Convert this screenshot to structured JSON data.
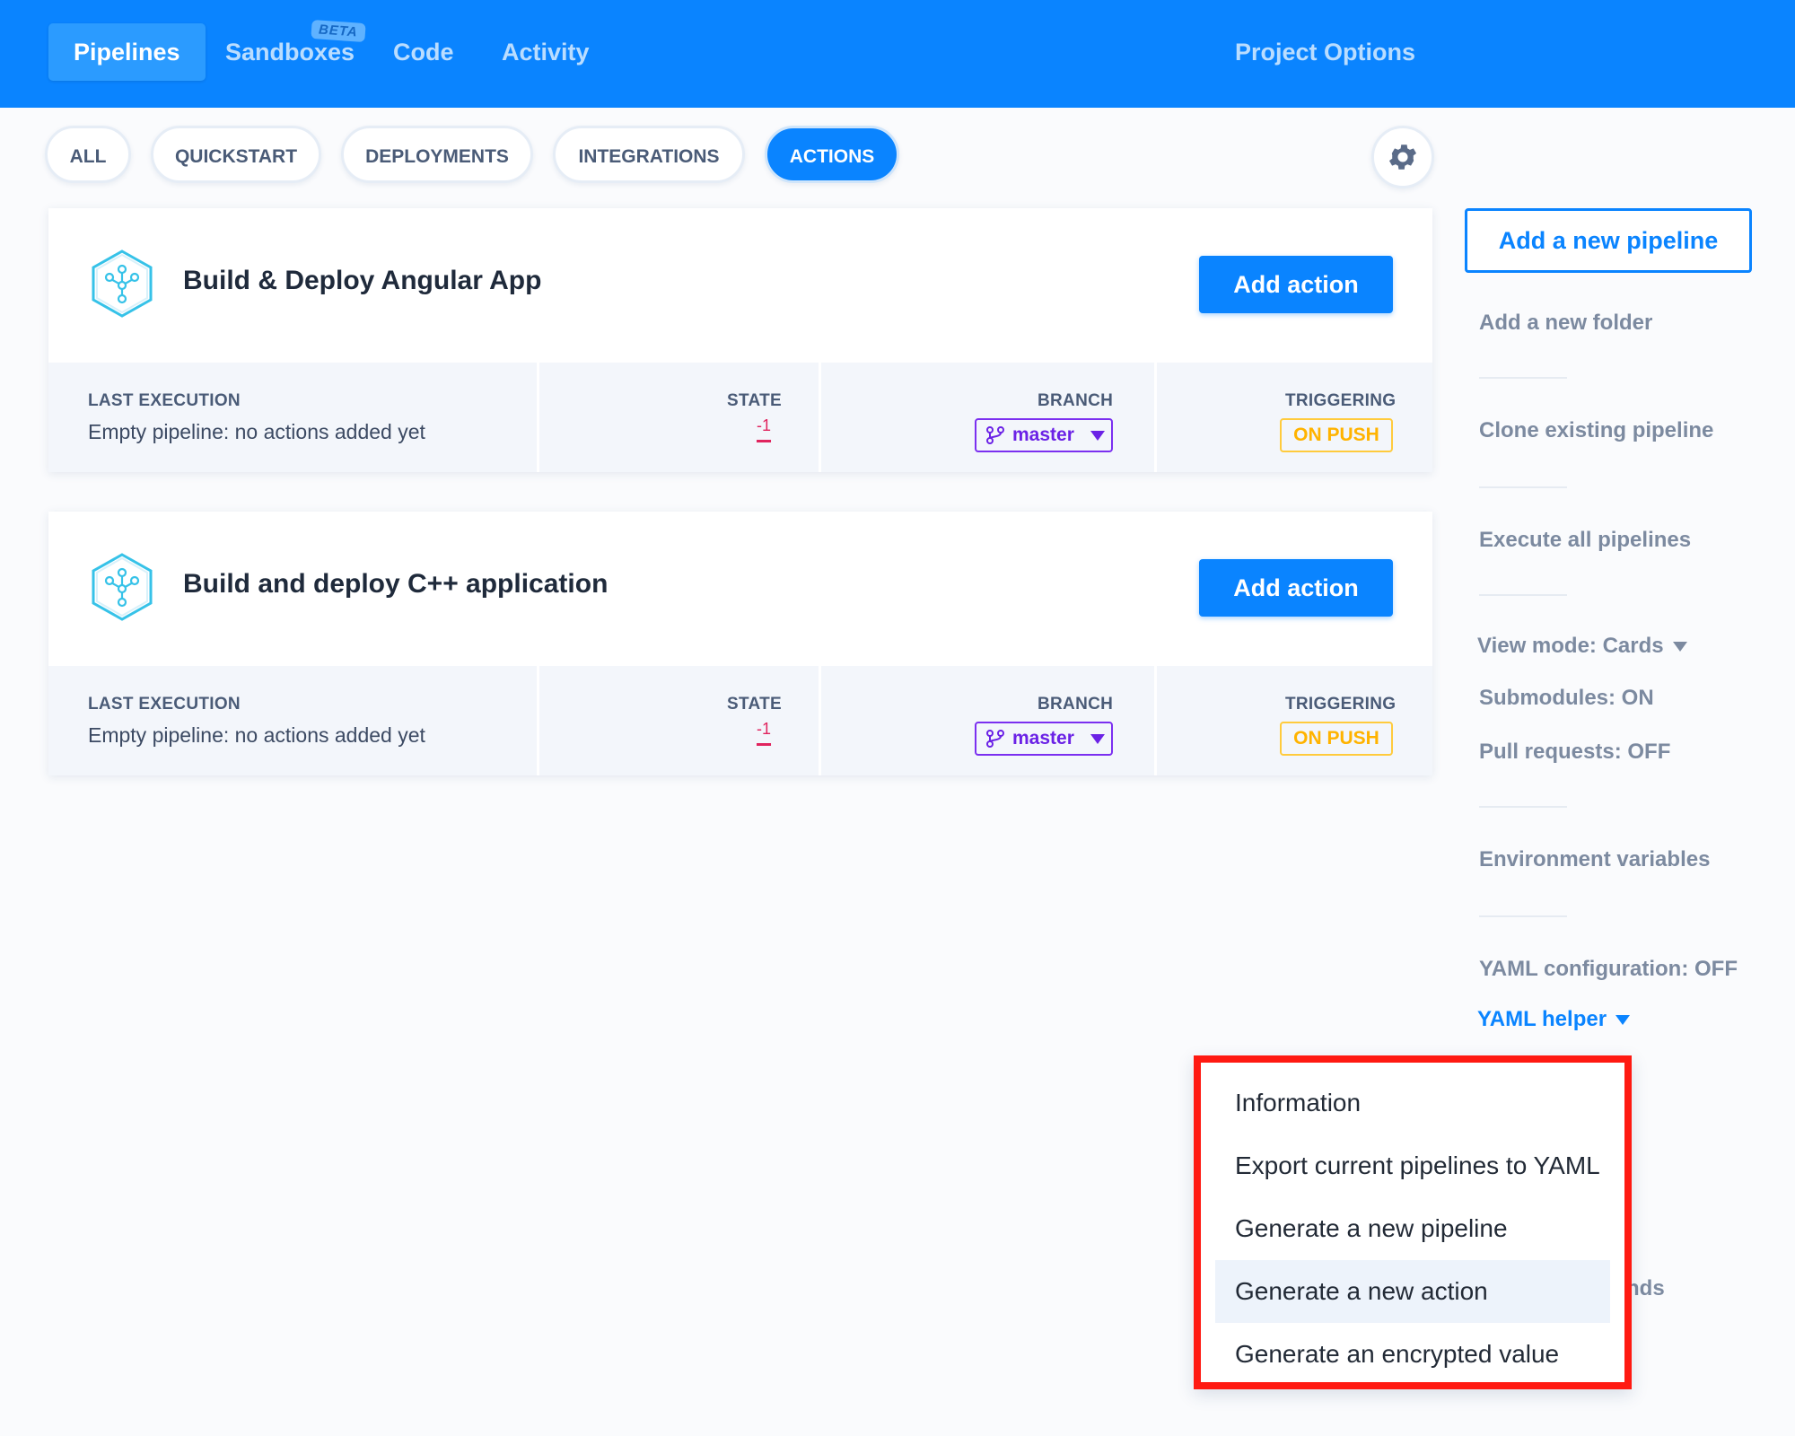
{
  "nav": {
    "items": [
      {
        "label": "Pipelines",
        "active": true
      },
      {
        "label": "Sandboxes",
        "active": false,
        "badge": "BETA"
      },
      {
        "label": "Code",
        "active": false
      },
      {
        "label": "Activity",
        "active": false
      }
    ],
    "project_options": "Project Options"
  },
  "filters": [
    {
      "label": "ALL",
      "active": false
    },
    {
      "label": "QUICKSTART",
      "active": false
    },
    {
      "label": "DEPLOYMENTS",
      "active": false
    },
    {
      "label": "INTEGRATIONS",
      "active": false
    },
    {
      "label": "ACTIONS",
      "active": true
    }
  ],
  "settings_icon": "gear-icon",
  "pipelines": [
    {
      "title": "Build & Deploy Angular App",
      "icon": "pipeline-hexagon-icon",
      "add_action_label": "Add action",
      "columns": {
        "last_execution_head": "LAST EXECUTION",
        "last_execution_value": "Empty pipeline: no actions added yet",
        "state_head": "STATE",
        "state_value": "-1",
        "branch_head": "BRANCH",
        "branch_value": "master",
        "triggering_head": "TRIGGERING",
        "triggering_value": "ON PUSH"
      }
    },
    {
      "title": "Build and deploy C++ application",
      "icon": "pipeline-hexagon-icon",
      "add_action_label": "Add action",
      "columns": {
        "last_execution_head": "LAST EXECUTION",
        "last_execution_value": "Empty pipeline: no actions added yet",
        "state_head": "STATE",
        "state_value": "-1",
        "branch_head": "BRANCH",
        "branch_value": "master",
        "triggering_head": "TRIGGERING",
        "triggering_value": "ON PUSH"
      }
    }
  ],
  "sidebar": {
    "add_pipeline": "Add a new pipeline",
    "add_folder": "Add a new folder",
    "clone_pipeline": "Clone existing pipeline",
    "execute_all": "Execute all pipelines",
    "view_mode": "View mode: Cards",
    "submodules": "Submodules: ON",
    "pull_requests": "Pull requests: OFF",
    "env_vars": "Environment variables",
    "yaml_config": "YAML configuration: OFF",
    "yaml_helper": "YAML helper",
    "hidden_fragment": "nds"
  },
  "yaml_menu": {
    "items": [
      "Information",
      "Export current pipelines to YAML",
      "Generate a new pipeline",
      "Generate a new action",
      "Generate an encrypted value"
    ],
    "highlighted": "Generate a new action"
  },
  "colors": {
    "brand_blue": "#0a84ff",
    "branch_purple": "#7b2ff0",
    "trigger_yellow": "#ffcb3d",
    "state_red": "#e0245e",
    "highlight_border": "#ff1a12"
  }
}
